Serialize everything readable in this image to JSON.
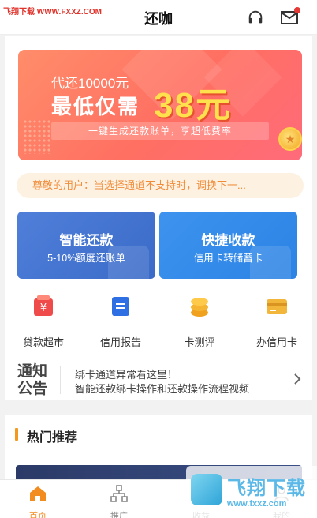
{
  "watermark_top": "飞翔下载 WWW.FXXZ.COM",
  "header": {
    "title": "还咖"
  },
  "banner": {
    "line1": "代还10000元",
    "line2": "最低仅需",
    "amount": "38元",
    "strip": "一键生成还款账单，享超低费率"
  },
  "notice": "尊敬的用户：当选择通道不支持时，调换下一...",
  "cards": [
    {
      "title": "智能还款",
      "subtitle": "5-10%额度还账单"
    },
    {
      "title": "快捷收款",
      "subtitle": "信用卡转储蓄卡"
    }
  ],
  "quick_links": [
    {
      "label": "贷款超市",
      "icon": "yen-bag-icon"
    },
    {
      "label": "信用报告",
      "icon": "report-icon"
    },
    {
      "label": "卡测评",
      "icon": "coin-stack-icon"
    },
    {
      "label": "办信用卡",
      "icon": "credit-card-icon"
    }
  ],
  "announcement": {
    "label": "通知公告",
    "line1": "绑卡通道异常看这里！",
    "line2": "智能还款绑卡操作和还款操作流程视频"
  },
  "hot": {
    "title": "热门推荐"
  },
  "tabbar": [
    {
      "label": "首页",
      "icon": "home-icon",
      "active": true
    },
    {
      "label": "推广",
      "icon": "network-icon",
      "active": false
    },
    {
      "label": "收益",
      "icon": "earnings-icon",
      "active": false
    },
    {
      "label": "我的",
      "icon": "profile-icon",
      "active": false
    }
  ],
  "watermark_corner": {
    "text": "飞翔下载",
    "url": "www.fxxz.com"
  },
  "colors": {
    "accent": "#f28c1e",
    "card_left": "#3a6bc8",
    "card_right": "#2c83e4",
    "notice_text": "#f08c38"
  }
}
